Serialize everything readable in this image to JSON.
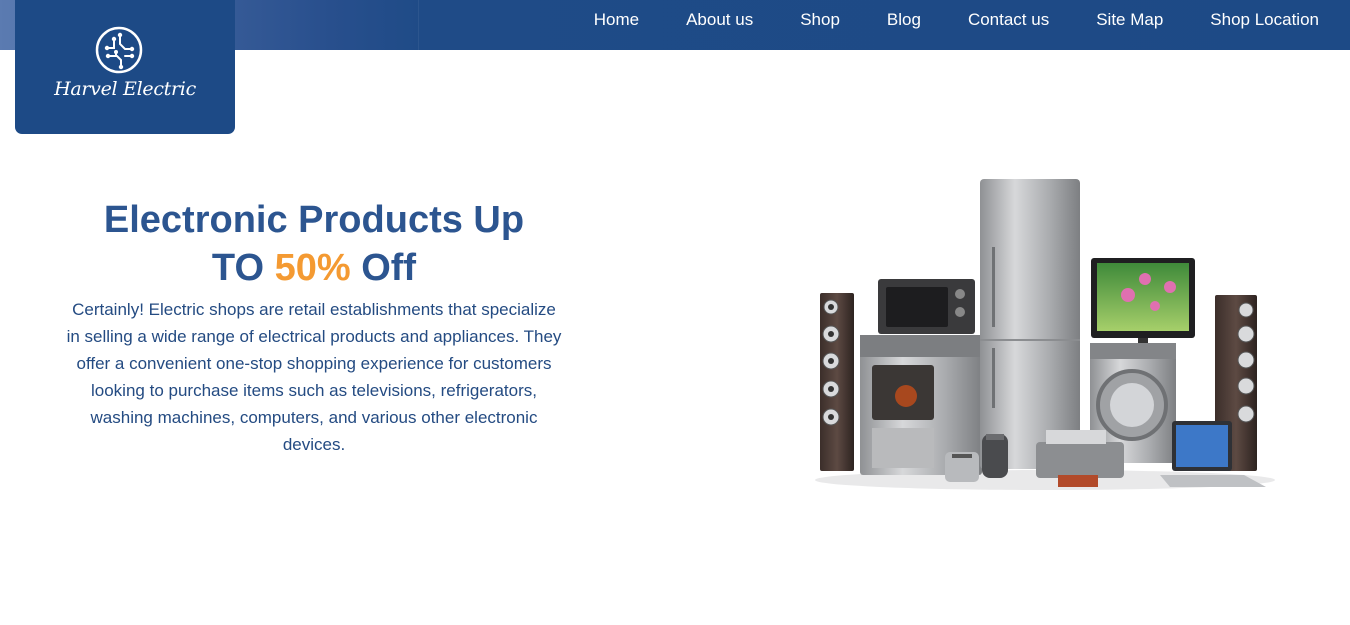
{
  "brand": {
    "name": "Harvel Electric",
    "logo_icon": "circuit-circle-icon"
  },
  "nav": {
    "items": [
      {
        "label": "Home"
      },
      {
        "label": "About us"
      },
      {
        "label": "Shop"
      },
      {
        "label": "Blog"
      },
      {
        "label": "Contact us"
      },
      {
        "label": "Site Map"
      },
      {
        "label": "Shop Location"
      }
    ]
  },
  "hero": {
    "title_line1": "Electronic Products Up",
    "title_prefix": "TO",
    "title_highlight": "50%",
    "title_suffix": "Off",
    "description": "Certainly! Electric shops are retail establishments that specialize in selling a wide range of electrical products and appliances. They offer a convenient one-stop shopping experience for customers looking to purchase items such as televisions, refrigerators, washing machines, computers, and various other electronic devices.",
    "image_alt": "electronic-appliances-collection"
  },
  "colors": {
    "nav_bg": "#1d4a86",
    "title": "#2c5590",
    "accent": "#f49a32",
    "body_text": "#244b82"
  }
}
